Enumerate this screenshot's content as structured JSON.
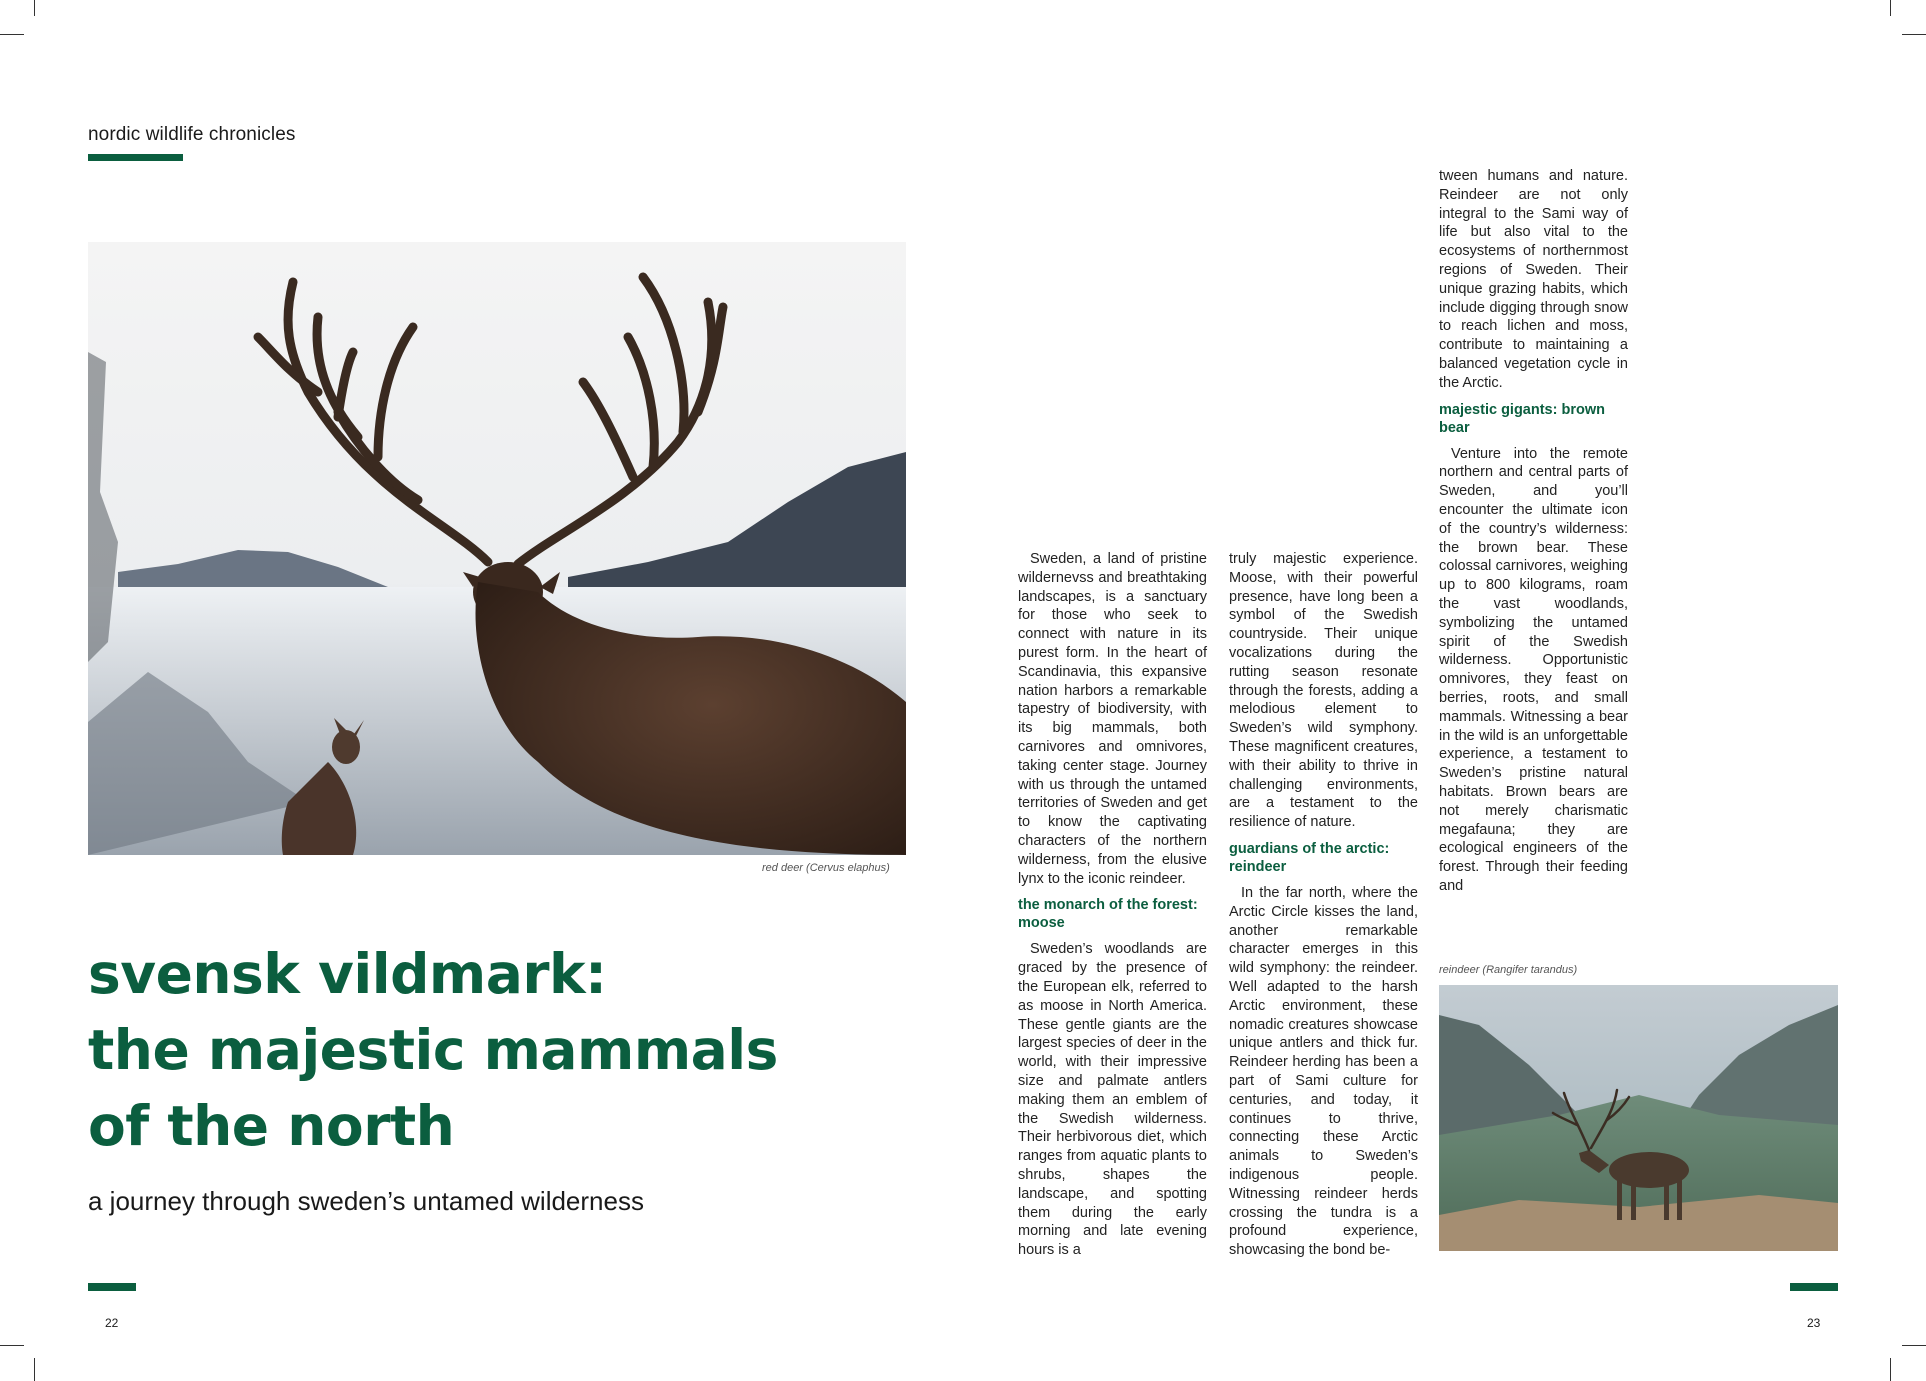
{
  "spread": {
    "running_head": "nordic wildlife chronicles",
    "page_left": "22",
    "page_right": "23",
    "accent_color": "#0b5e3f"
  },
  "hero_image": {
    "caption": "red deer (Cervus elaphus)"
  },
  "headline": {
    "line1": "svensk vildmark:",
    "line2": "the majestic mammals",
    "line3": "of the north",
    "subtitle": "a journey through sweden’s untamed wilderness"
  },
  "article": {
    "col1_intro": "Sweden, a land of pristine wildernevss and breathtaking landscapes, is a sanctuary for those who seek to connect with nature in its purest form. In the heart of Scandinavia, this expansive nation harbors a remarkable tapestry of biodiversity, with its big mammals, both carnivores and omnivores, taking center stage. Journey with us through the untamed territories of Sweden and get to know the captivating characters of the northern wilderness, from the elusive lynx to the iconic reindeer.",
    "moose_heading": "the monarch of the forest: moose",
    "moose_text": "Sweden’s woodlands are graced by the presence of the European elk, referred to as moose in North America. These gentle giants are the largest species of deer in the world, with their impressive size and palmate antlers making them an emblem of the Swedish wilderness. Their herbivorous diet, which ranges from aquatic plants to shrubs, shapes the landscape, and spotting them during the early morning and late evening hours is a",
    "col2_cont": "truly majestic experience. Moose, with their powerful presence, have long been a symbol of the Swedish countryside. Their unique vocalizations during the rutting season resonate through the forests, adding a melodious element to Sweden’s wild symphony. These magnificent creatures, with their ability to thrive in challenging environments, are a testament to the resilience of nature.",
    "reindeer_heading": "guardians of the arctic: reindeer",
    "reindeer_text": "In the far north, where the Arctic Circle kisses the land, another remarkable character emerges in this wild symphony: the reindeer. Well adapted to the harsh Arctic environment, these nomadic creatures showcase unique antlers and thick fur. Reindeer herding has been a part of Sami culture for centuries, and today, it continues to thrive, connecting these Arctic animals to Sweden’s indigenous people. Witnessing reindeer herds crossing the tundra is a profound experience, showcasing the bond be-",
    "col3_cont": "tween humans and nature. Reindeer are not only integral to the Sami way of life but also vital to the ecosystems of northernmost regions of Sweden. Their unique grazing habits, which include digging through snow to reach lichen and moss, contribute to maintaining a balanced vegetation cycle in the Arctic.",
    "bear_heading": "majestic gigants: brown bear",
    "bear_text": "Venture into the remote northern and central parts of Sweden, and you’ll encounter the ultimate icon of the country’s wilderness: the brown bear. These colossal carnivores, weighing up to 800 kilograms, roam the vast woodlands, symbolizing the untamed spirit of the Swedish wilderness. Opportunistic omnivores, they feast on berries, roots, and small mammals. Witnessing a bear in the wild is an unforgettable experience, a testament to Sweden’s pristine natural habitats. Brown bears are not merely charismatic megafauna; they are ecological engineers of the forest. Through their feeding and"
  },
  "reindeer_image": {
    "caption": "reindeer (Rangifer tarandus)"
  }
}
